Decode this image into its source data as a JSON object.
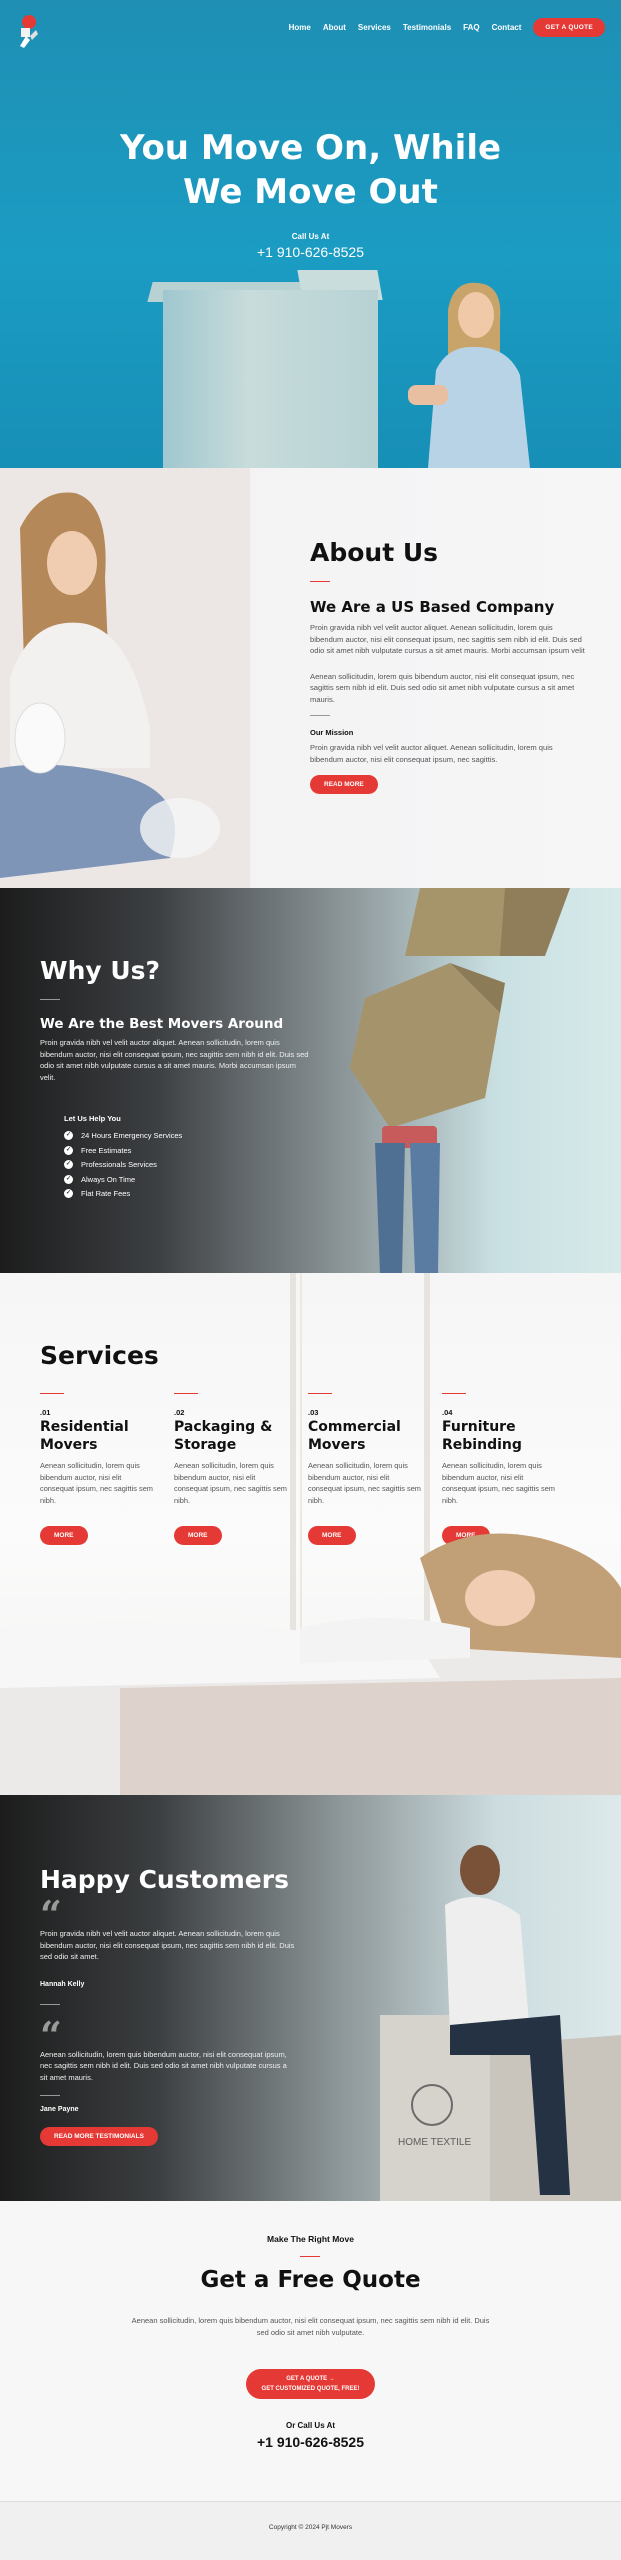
{
  "nav": {
    "items": [
      "Home",
      "About",
      "Services",
      "Testimonials",
      "FAQ",
      "Contact"
    ],
    "cta": "GET A QUOTE",
    "logo_icon": "mover-logo-icon"
  },
  "hero": {
    "title_line1": "You Move On, While",
    "title_line2": "We Move Out",
    "call_label": "Call Us At",
    "phone": "+1 910-626-8525"
  },
  "about": {
    "title": "About Us",
    "subtitle": "We Are a US Based Company",
    "para1": "Proin gravida nibh vel velit auctor aliquet. Aenean sollicitudin, lorem quis bibendum auctor, nisi elit consequat ipsum, nec sagittis sem nibh id elit. Duis sed odio sit amet nibh vulputate cursus a sit amet mauris. Morbi accumsan ipsum velit",
    "para2": "Aenean sollicitudin, lorem quis bibendum auctor, nisi elit consequat ipsum, nec sagittis sem nibh id elit. Duis sed odio sit amet nibh vulputate cursus a sit amet mauris.",
    "mission_title": "Our Mission",
    "mission_text": "Proin gravida nibh vel velit auctor aliquet. Aenean sollicitudin, lorem quis bibendum auctor, nisi elit consequat ipsum, nec sagittis.",
    "button": "READ MORE"
  },
  "why": {
    "title": "Why Us?",
    "subtitle": "We Are the Best Movers Around",
    "text": "Proin gravida nibh vel velit auctor aliquet. Aenean sollicitudin, lorem quis bibendum auctor, nisi elit consequat ipsum, nec sagittis sem nibh id elit. Duis sed odio sit amet nibh vulputate cursus a sit amet mauris. Morbi accumsan ipsum velit.",
    "helps_title": "Let Us Help You",
    "helps": [
      "24 Hours Emergency Services",
      "Free Estimates",
      "Professionals Services",
      "Always On Time",
      "Flat Rate Fees"
    ]
  },
  "services": {
    "title": "Services",
    "items": [
      {
        "num": ".01",
        "title_l1": "Residential",
        "title_l2": "Movers",
        "text": "Aenean sollicitudin, lorem quis bibendum auctor, nisi elit consequat ipsum, nec sagittis sem nibh.",
        "button": "MORE"
      },
      {
        "num": ".02",
        "title_l1": "Packaging &",
        "title_l2": "Storage",
        "text": "Aenean sollicitudin, lorem quis bibendum auctor, nisi elit consequat ipsum, nec sagittis sem nibh.",
        "button": "MORE"
      },
      {
        "num": ".03",
        "title_l1": "Commercial",
        "title_l2": "Movers",
        "text": "Aenean sollicitudin, lorem quis bibendum auctor, nisi elit consequat ipsum, nec sagittis sem nibh.",
        "button": "MORE"
      },
      {
        "num": ".04",
        "title_l1": "Furniture",
        "title_l2": "Rebinding",
        "text": "Aenean sollicitudin, lorem quis bibendum auctor, nisi elit consequat ipsum, nec sagittis sem nibh.",
        "button": "MORE"
      }
    ]
  },
  "customers": {
    "title": "Happy Customers",
    "quote1": "Proin gravida nibh vel velit auctor aliquet. Aenean sollicitudin, lorem quis bibendum auctor, nisi elit consequat ipsum, nec sagittis sem nibh id elit. Duis sed odio sit amet.",
    "author1": "Hannah Kelly",
    "quote2": "Aenean sollicitudin, lorem quis bibendum auctor, nisi elit consequat ipsum, nec sagittis sem nibh id elit. Duis sed odio sit amet nibh vulputate cursus a sit amet mauris.",
    "author2": "Jane Payne",
    "button": "READ MORE TESTIMONIALS",
    "box_text": "HOME TEXTILE"
  },
  "quote": {
    "pre": "Make The Right Move",
    "title": "Get a Free Quote",
    "text": "Aenean sollicitudin, lorem quis bibendum auctor, nisi elit consequat ipsum, nec sagittis sem nibh id elit. Duis sed odio sit amet nibh vulputate.",
    "button_line1": "GET A QUOTE →",
    "button_line2": "GET CUSTOMIZED QUOTE, FREE!",
    "or_call": "Or Call Us At",
    "phone": "+1 910-626-8525"
  },
  "footer": {
    "copyright": "Copyright © 2024 Pjt Movers"
  },
  "colors": {
    "accent": "#e53935",
    "hero_bg": "#1b9cc3"
  }
}
